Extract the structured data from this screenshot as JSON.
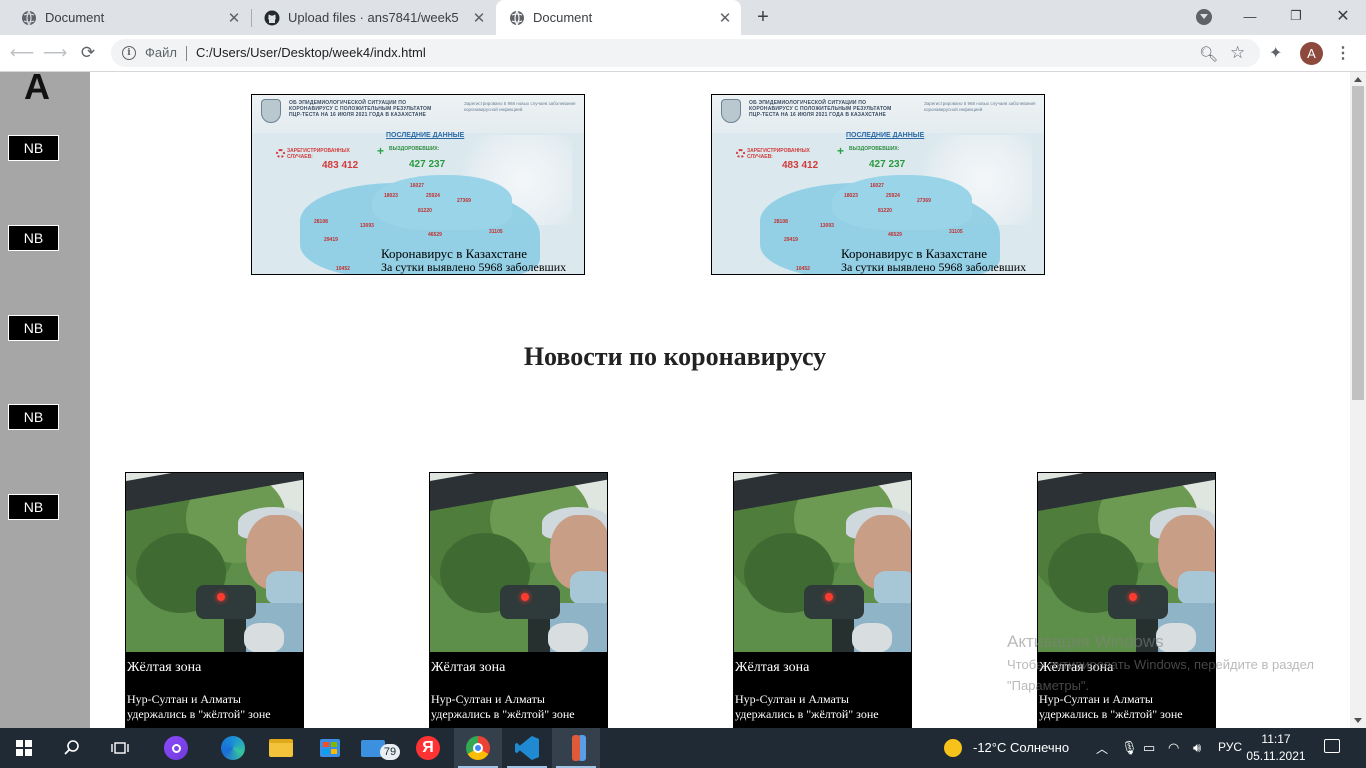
{
  "browser": {
    "tabs": [
      {
        "title": "Document",
        "favicon": "globe-icon",
        "active": false
      },
      {
        "title": "Upload files · ans7841/week5",
        "favicon": "github-icon",
        "active": false
      },
      {
        "title": "Document",
        "favicon": "globe-icon",
        "active": true
      }
    ],
    "new_tab": "+",
    "omnibox": {
      "scheme_label": "Файл",
      "url": "C:/Users/User/Desktop/week4/indx.html"
    },
    "profile_initial": "A"
  },
  "page": {
    "logo": "A",
    "sidebar_buttons": [
      "NB",
      "NB",
      "NB",
      "NB",
      "NB"
    ],
    "banners": [
      {
        "headline": "ОБ ЭПИДЕМИОЛОГИЧЕСКОЙ СИТУАЦИИ ПО КОРОНАВИРУСУ С ПОЛОЖИТЕЛЬНЫМ РЕЗУЛЬТАТОМ ПЦР-ТЕСТА НА 16 ИЮЛЯ 2021 ГОДА В КАЗАХСТАНЕ",
        "note": "Зарегистрировано 5 968 новых случаев заболевания коронавирусной инфекцией",
        "latest": "ПОСЛЕДНИЕ ДАННЫЕ",
        "registered_label": "ЗАРЕГИСТРИРОВАННЫХ СЛУЧАЕВ:",
        "registered": "483 412",
        "recovered_label": "ВЫЗДОРОВЕВШИХ:",
        "recovered": "427 237",
        "region_numbers": [
          "16027",
          "18023",
          "25924",
          "27369",
          "81220",
          "28108",
          "13093",
          "46529",
          "31105",
          "29419",
          "10452"
        ],
        "caption": "Коронавирус в Казахстане",
        "subcaption": "За сутки выявлено 5968 заболевших"
      },
      {
        "headline": "ОБ ЭПИДЕМИОЛОГИЧЕСКОЙ СИТУАЦИИ ПО КОРОНАВИРУСУ С ПОЛОЖИТЕЛЬНЫМ РЕЗУЛЬТАТОМ ПЦР-ТЕСТА НА 16 ИЮЛЯ 2021 ГОДА В КАЗАХСТАНЕ",
        "note": "Зарегистрировано 5 968 новых случаев заболевания коронавирусной инфекцией",
        "latest": "ПОСЛЕДНИЕ ДАННЫЕ",
        "registered_label": "ЗАРЕГИСТРИРОВАННЫХ СЛУЧАЕВ:",
        "registered": "483 412",
        "recovered_label": "ВЫЗДОРОВЕВШИХ:",
        "recovered": "427 237",
        "region_numbers": [
          "16027",
          "18023",
          "25924",
          "27369",
          "81220",
          "28108",
          "13093",
          "46529",
          "31105",
          "29419",
          "10452"
        ],
        "caption": "Коронавирус в Казахстане",
        "subcaption": "За сутки выявлено 5968 заболевших"
      }
    ],
    "section_title": "Новости по коронавирусу",
    "news": [
      {
        "title": "Жёлтая зона",
        "text": "Нур-Султан и Алматы удержались в \"жёлтой\" зоне"
      },
      {
        "title": "Жёлтая зона",
        "text": "Нур-Султан и Алматы удержались в \"жёлтой\" зоне"
      },
      {
        "title": "Жёлтая зона",
        "text": "Нур-Султан и Алматы удержались в \"жёлтой\" зоне"
      },
      {
        "title": "Жёлтая зона",
        "text": "Нур-Султан и Алматы удержались в \"жёлтой\" зоне"
      }
    ]
  },
  "watermark": {
    "title": "Активация Windows",
    "text": "Чтобы активировать Windows, перейдите в раздел \"Параметры\"."
  },
  "taskbar": {
    "mail_badge": "79",
    "weather": "-12°C  Солнечно",
    "language": "РУС",
    "time": "11:17",
    "date": "05.11.2021"
  }
}
